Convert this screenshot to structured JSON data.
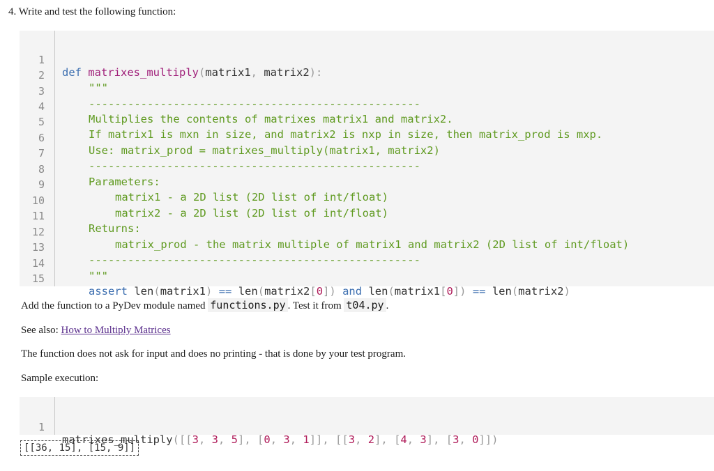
{
  "heading": "4. Write and test the following function:",
  "code1": {
    "line_numbers": [
      "1",
      "2",
      "3",
      "4",
      "5",
      "6",
      "7",
      "8",
      "9",
      "10",
      "11",
      "12",
      "13",
      "14",
      "15"
    ],
    "l1": {
      "kw": "def",
      "fn": "matrixes_multiply",
      "open": "(",
      "a1": "matrix1",
      "comma": ",",
      "a2": "matrix2",
      "close": "):"
    },
    "l2": "\"\"\"",
    "l3": "---------------------------------------------------",
    "l4": "Multiplies the contents of matrixes matrix1 and matrix2.",
    "l5": "If matrix1 is mxn in size, and matrix2 is nxp in size, then matrix_prod is mxp.",
    "l6": "Use: matrix_prod = matrixes_multiply(matrix1, matrix2)",
    "l7": "---------------------------------------------------",
    "l8": "Parameters:",
    "l9": "matrix1 - a 2D list (2D list of int/float)",
    "l10": "matrix2 - a 2D list (2D list of int/float)",
    "l11": "Returns:",
    "l12": "matrix_prod - the matrix multiple of matrix1 and matrix2 (2D list of int/float)",
    "l13": "---------------------------------------------------",
    "l14": "\"\"\"",
    "l15": {
      "assert": "assert",
      "len1": "len",
      "p1": "(",
      "m1": "matrix1",
      "p2": ")",
      "eq1": "==",
      "len2": "len",
      "p3": "(",
      "m2": "matrix2",
      "b1": "[",
      "z1": "0",
      "b2": "])",
      "and": "and",
      "len3": "len",
      "p4": "(",
      "m3": "matrix1",
      "b3": "[",
      "z2": "0",
      "b4": "])",
      "eq2": "==",
      "len4": "len",
      "p5": "(",
      "m4": "matrix2",
      "p6": ")"
    }
  },
  "para1": {
    "pre": "Add the function to a PyDev module named ",
    "code_a": "functions.py",
    "mid": ". Test it from ",
    "code_b": "t04.py",
    "post": "."
  },
  "para2": {
    "pre": "See also: ",
    "link": "How to Multiply Matrices"
  },
  "para3": "The function does not ask for input and does no printing - that is done by your test program.",
  "para4": "Sample execution:",
  "code2": {
    "line_number": "1",
    "fn": "matrixes_multiply",
    "tokens": [
      "([[",
      "3",
      ", ",
      "3",
      ", ",
      "5",
      "], [",
      "0",
      ", ",
      "3",
      ", ",
      "1",
      "]], [[",
      "3",
      ", ",
      "2",
      "], [",
      "4",
      ", ",
      "3",
      "], [",
      "3",
      ", ",
      "0",
      "]])"
    ]
  },
  "output": "[[36, 15], [15, 9]]",
  "colors": {
    "keyword": "#3d6fb0",
    "function": "#a0207a",
    "docstring": "#5f9a20",
    "number": "#b01c5a",
    "code_bg": "#f4f4f4",
    "link": "#5a2e8c"
  }
}
